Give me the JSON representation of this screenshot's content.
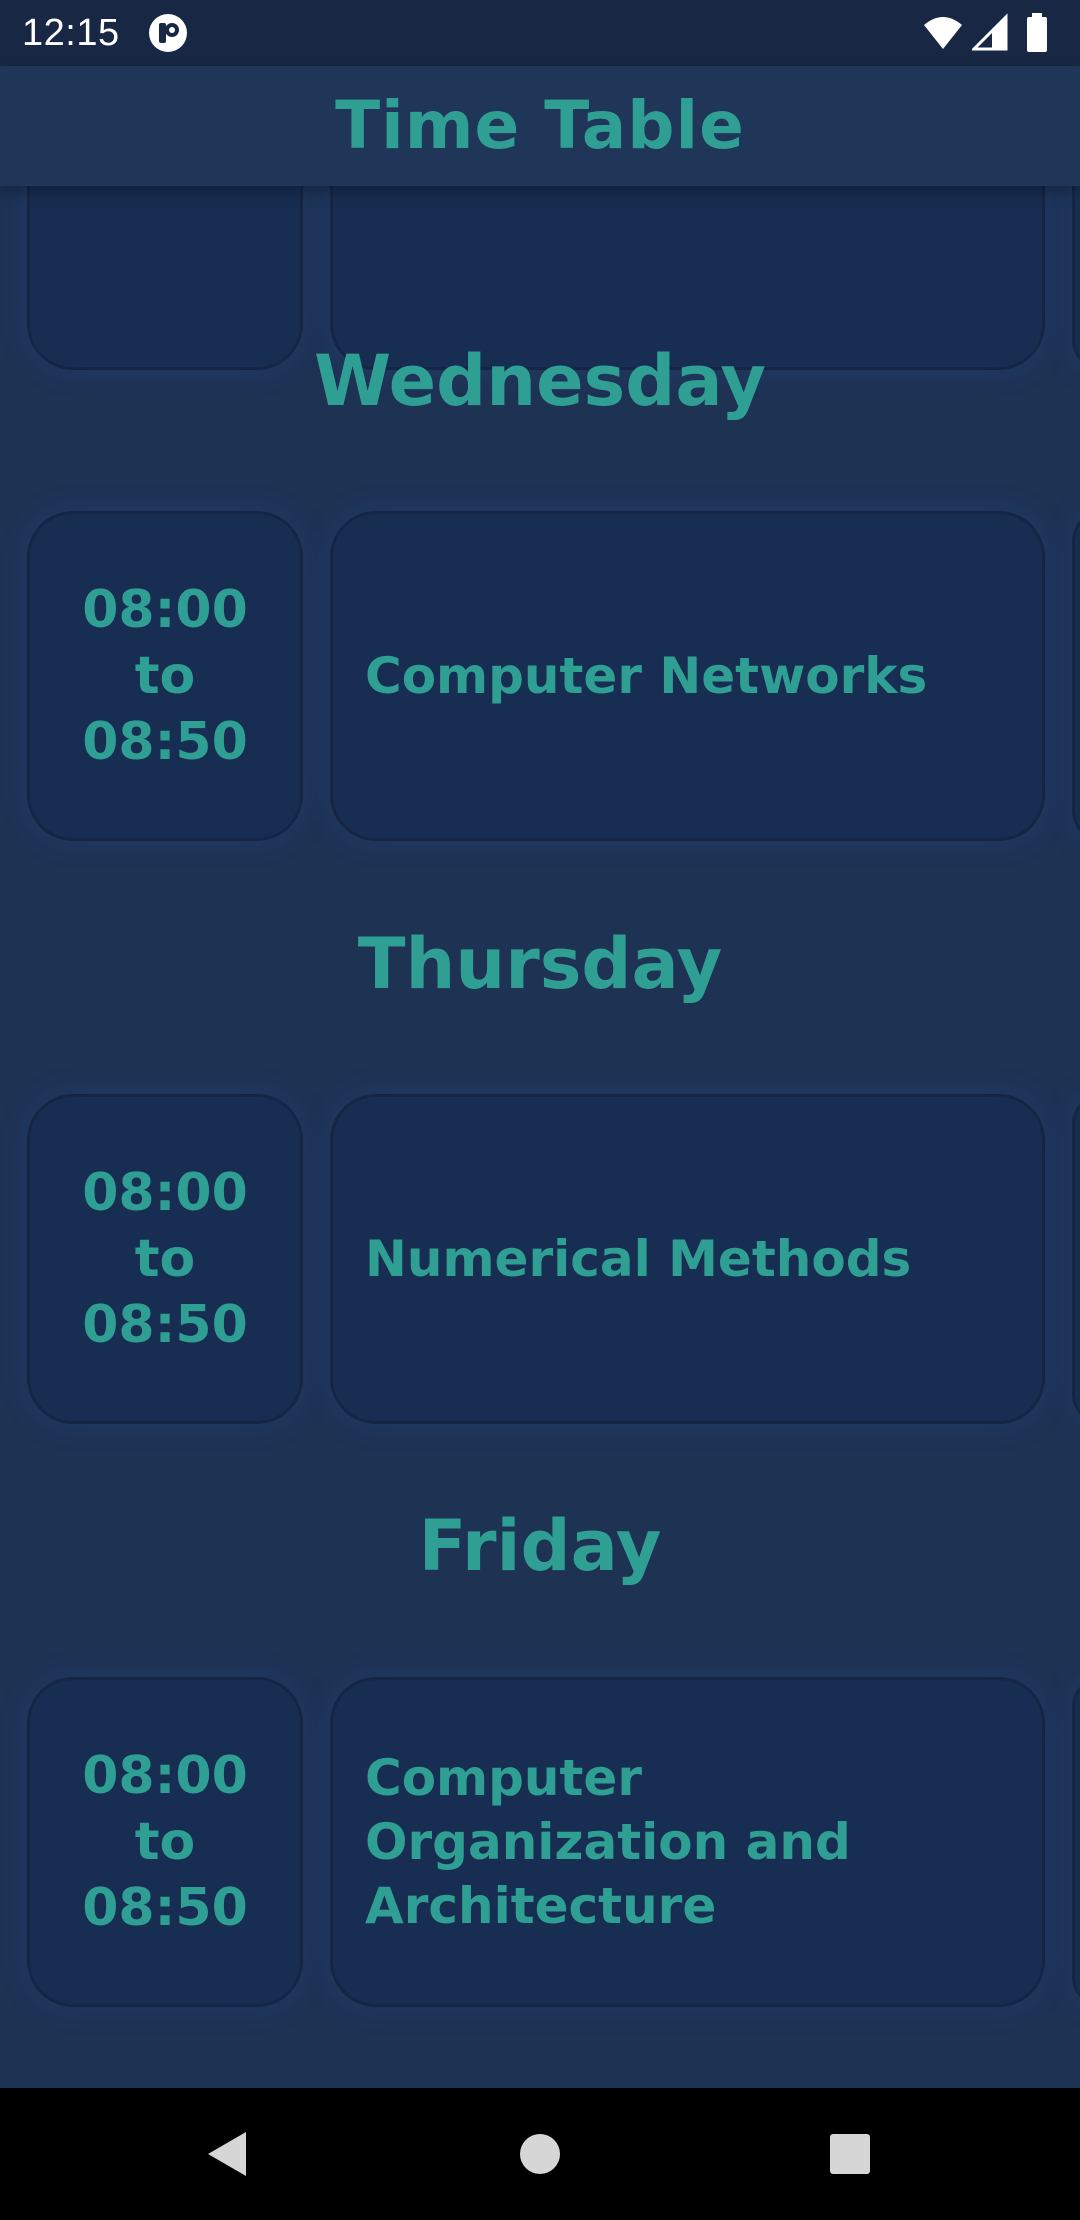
{
  "status_bar": {
    "time": "12:15",
    "icons": [
      "app-notification-icon",
      "wifi-icon",
      "cellular-signal-icon",
      "battery-icon"
    ]
  },
  "header": {
    "title": "Time Table"
  },
  "schedule": [
    {
      "day": "Wednesday",
      "entries": [
        {
          "time_start": "08:00",
          "time_sep": "to",
          "time_end": "08:50",
          "subject": "Computer Networks"
        }
      ]
    },
    {
      "day": "Thursday",
      "entries": [
        {
          "time_start": "08:00",
          "time_sep": "to",
          "time_end": "08:50",
          "subject": "Numerical Methods"
        }
      ]
    },
    {
      "day": "Friday",
      "entries": [
        {
          "time_start": "08:00",
          "time_sep": "to",
          "time_end": "08:50",
          "subject": "Computer Organization and Architecture"
        }
      ]
    }
  ],
  "nav_bar": {
    "buttons": [
      "back-icon",
      "home-icon",
      "recents-icon"
    ]
  },
  "colors": {
    "background": "#1e3254",
    "card": "#182d52",
    "accent_text": "#2f9f94",
    "status_bar": "#182844",
    "nav_bar": "#000000"
  }
}
